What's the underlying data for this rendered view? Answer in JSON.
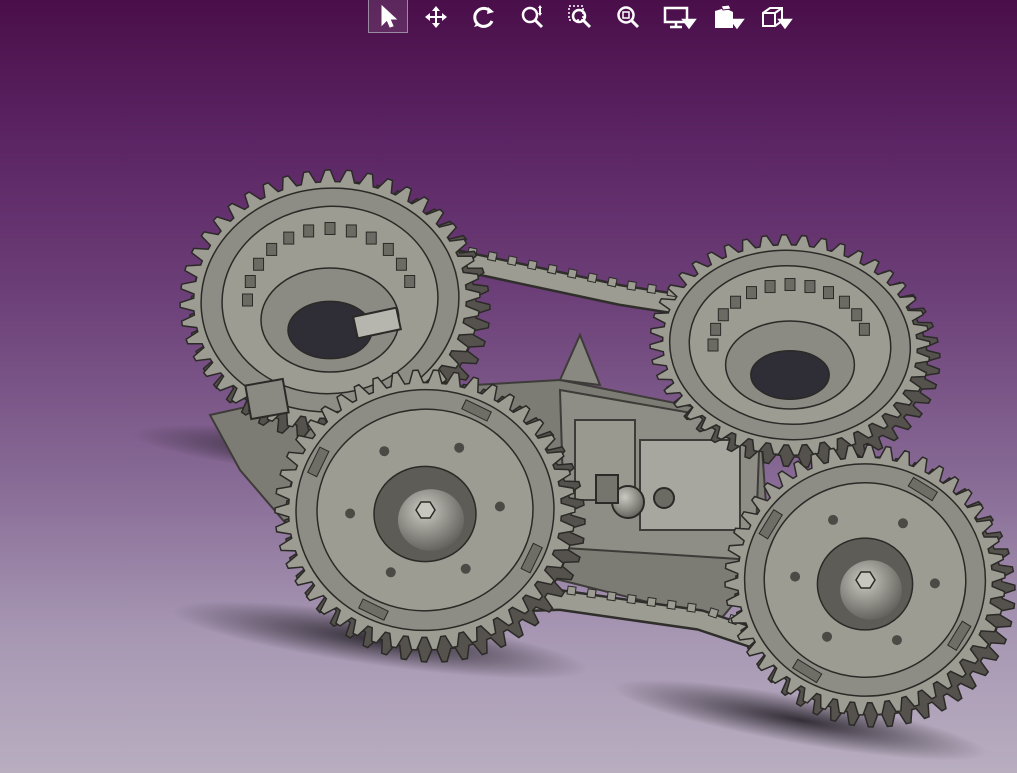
{
  "viewer": {
    "background_top": "#4a0f4a",
    "background_bottom": "#b8aec0",
    "part_color": "#9c9c92",
    "part_shadow": "#55524d"
  },
  "toolbar": {
    "buttons": [
      {
        "name": "select",
        "icon": "cursor-arrow-icon",
        "active": true,
        "dropdown": false
      },
      {
        "name": "pan",
        "icon": "move-arrows-icon",
        "active": false,
        "dropdown": false
      },
      {
        "name": "rotate",
        "icon": "rotate-icon",
        "active": false,
        "dropdown": false
      },
      {
        "name": "zoom",
        "icon": "zoom-icon",
        "active": false,
        "dropdown": false
      },
      {
        "name": "zoom-area",
        "icon": "zoom-area-icon",
        "active": false,
        "dropdown": false
      },
      {
        "name": "zoom-fit",
        "icon": "zoom-fit-icon",
        "active": false,
        "dropdown": false
      },
      {
        "name": "display-mode",
        "icon": "monitor-icon",
        "active": false,
        "dropdown": true
      },
      {
        "name": "view-orientation",
        "icon": "document-views-icon",
        "active": false,
        "dropdown": true
      },
      {
        "name": "standard-views",
        "icon": "cube-icon",
        "active": false,
        "dropdown": true
      }
    ]
  }
}
